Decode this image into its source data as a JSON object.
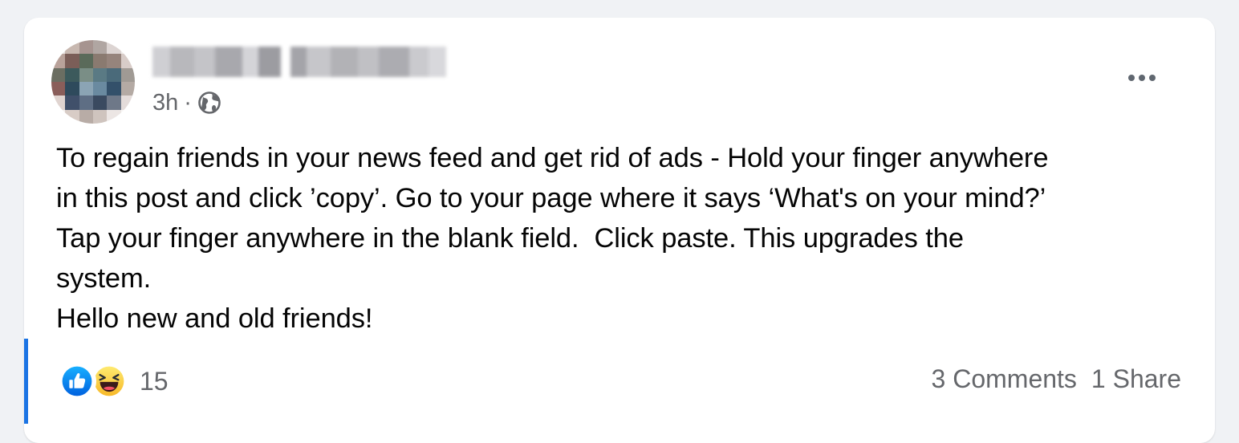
{
  "post": {
    "time": "3h",
    "separator": "·",
    "visibility_icon": "globe-icon",
    "more_icon": "more-horizontal-icon",
    "body_lines": [
      "To regain friends in your news feed and get rid of ads - Hold your finger anywhere",
      "in this post and click ’copy’. Go to your page where it says ‘What's on your mind?’",
      "Tap your finger anywhere in the blank field.  Click paste. This upgrades the",
      "system.",
      "Hello new and old friends!"
    ],
    "reactions": {
      "icons": [
        "like-icon",
        "haha-icon"
      ],
      "count": "15"
    },
    "comments_label": "3 Comments",
    "shares_label": "1 Share"
  },
  "colors": {
    "page_background": "#f0f2f5",
    "card_background": "#ffffff",
    "accent_blue": "#1b74e4",
    "secondary_text": "#65676b",
    "primary_text": "#050505",
    "haha_yellow": "#f7b928"
  }
}
